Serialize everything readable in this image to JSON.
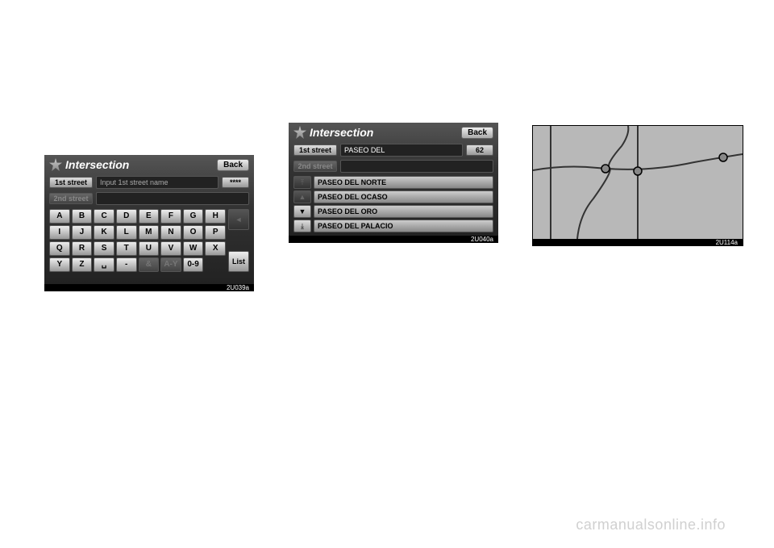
{
  "watermark": "carmanualsonline.info",
  "screen1": {
    "title": "Intersection",
    "back": "Back",
    "count": "****",
    "field1_label": "1st street",
    "field1_value": "Input 1st street name",
    "field2_label": "2nd street",
    "field2_value": "",
    "keys": [
      "A",
      "B",
      "C",
      "D",
      "E",
      "F",
      "G",
      "H",
      "I",
      "J",
      "K",
      "L",
      "M",
      "N",
      "O",
      "P",
      "Q",
      "R",
      "S",
      "T",
      "U",
      "V",
      "W",
      "X",
      "Y",
      "Z",
      "␣",
      "-",
      "&",
      "A-Y",
      "0-9"
    ],
    "dimKeys": [
      "&",
      "A-Y"
    ],
    "deleteIcon": "◄",
    "listBtn": "List",
    "imgLabel": "2U039a"
  },
  "screen2": {
    "title": "Intersection",
    "back": "Back",
    "field1_label": "1st street",
    "field1_value": "PASEO DEL",
    "count": "62",
    "field2_label": "2nd street",
    "field2_value": "",
    "nav": [
      "⤒",
      "▲",
      "▼",
      "⤓"
    ],
    "dimNav": [
      "⤒",
      "▲"
    ],
    "items": [
      "PASEO DEL NORTE",
      "PASEO DEL OCASO",
      "PASEO DEL ORO",
      "PASEO DEL PALACIO"
    ],
    "imgLabel": "2U040a"
  },
  "screen3": {
    "imgLabel": "2U114a"
  }
}
